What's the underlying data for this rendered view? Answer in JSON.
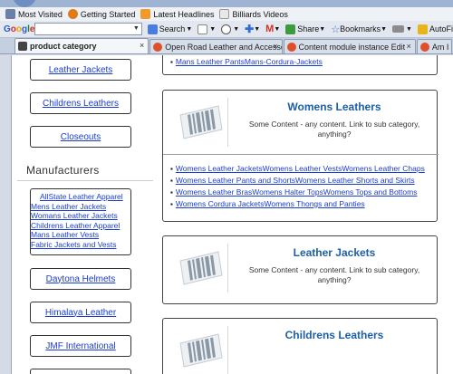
{
  "bookmarks": [
    {
      "label": "Most Visited",
      "icon": "bookmark-star-icon",
      "color": "#6b7fa8"
    },
    {
      "label": "Getting Started",
      "icon": "firefox-icon",
      "color": "#e07b1a"
    },
    {
      "label": "Latest Headlines",
      "icon": "rss-icon",
      "color": "#f19a2b"
    },
    {
      "label": "Billiards Videos",
      "icon": "page-icon",
      "color": "#c9c9c9"
    }
  ],
  "toolbar": {
    "brand": "Google",
    "search_value": "",
    "search_label": "Search",
    "share_label": "Share",
    "bookmarks_label": "Bookmarks",
    "autofill_label": "AutoFi"
  },
  "tabs": [
    {
      "label": "product category",
      "active": true,
      "close": "×"
    },
    {
      "label": "Open Road Leather and Accessori...",
      "active": false,
      "close": "×"
    },
    {
      "label": "Content module instance Edit",
      "active": false,
      "close": "×"
    },
    {
      "label": "Am I",
      "active": false,
      "close": ""
    }
  ],
  "sidebar": {
    "categories": [
      "Leather Jackets",
      "Childrens Leathers",
      "Closeouts"
    ],
    "manufacturers_title": "Manufacturers",
    "manufacturer_links": [
      "AllState Leather Apparel",
      "Mens Leather Jackets",
      "Womans Leather Jackets",
      "Childrens Leather Apparel",
      "Mans Leather Vests",
      "Fabric Jackets and Vests"
    ],
    "manufacturers": [
      "Daytona Helmets",
      "Himalaya Leather",
      "JMF International"
    ]
  },
  "main": {
    "top_link": "Mans Leather PantsMans-Cordura-Jackets",
    "panels": [
      {
        "title": "Womens Leathers",
        "description": "Some Content - any content. Link to sub category, anything?",
        "links": [
          "Womens Leather JacketsWomens Leather VestsWomens Leather Chaps",
          "Womens Leather Pants and ShortsWomens Leather Shorts and Skirts",
          "Womens Leather BrasWomens Halter TopsWomens Tops and Bottoms",
          "Womens Cordura JacketsWomens Thongs and Panties"
        ]
      },
      {
        "title": "Leather Jackets",
        "description": "Some Content - any content. Link to sub category, anything?",
        "links": []
      },
      {
        "title": "Childrens Leathers",
        "description": "",
        "links": []
      }
    ]
  },
  "colors": {
    "link": "#1a3ccf",
    "panel_title": "#1c5fa8"
  }
}
